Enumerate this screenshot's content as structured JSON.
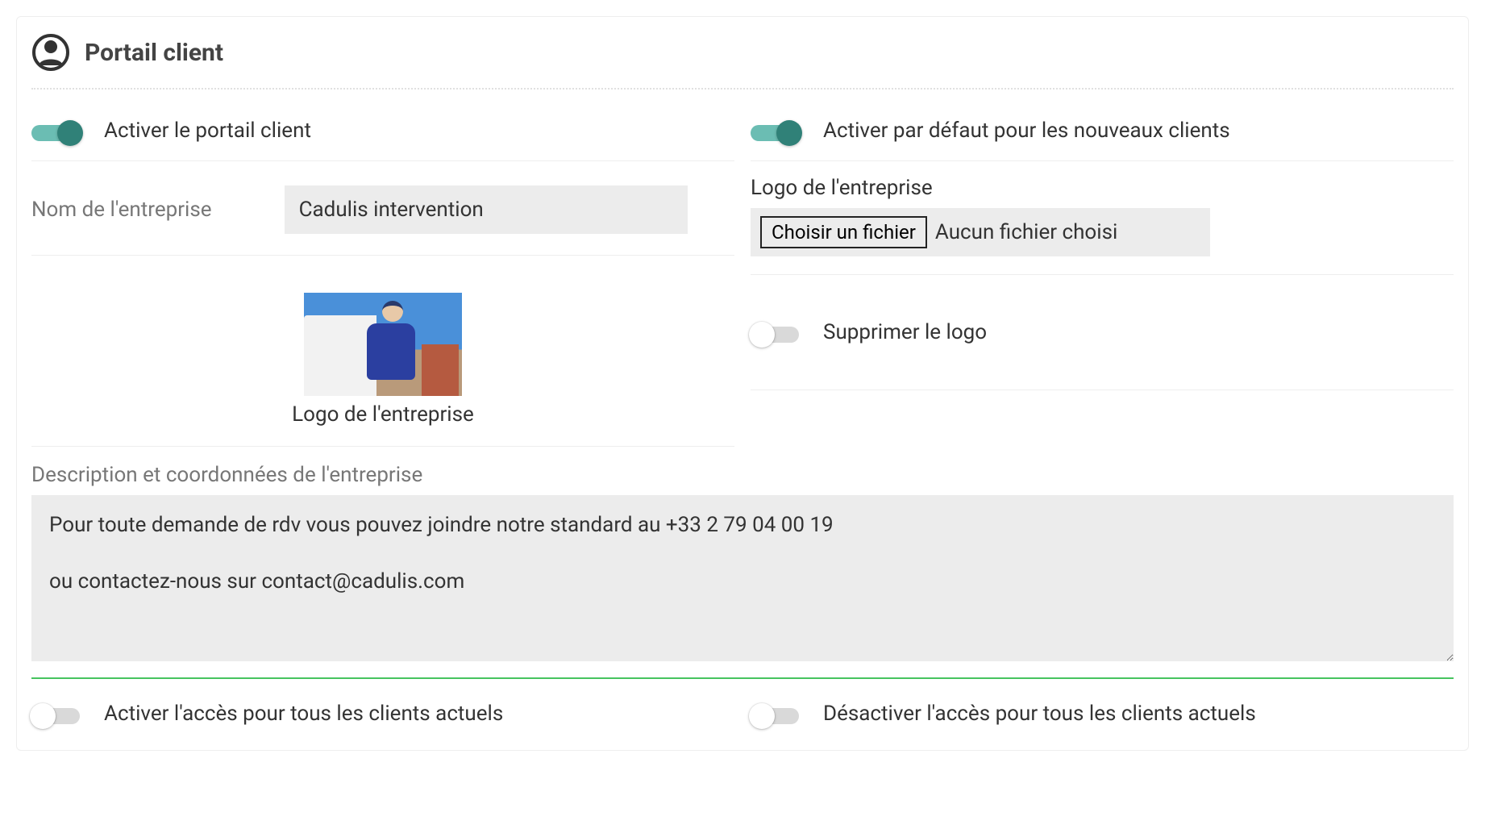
{
  "header": {
    "title": "Portail client"
  },
  "toggles": {
    "enable_portal": {
      "label": "Activer le portail client",
      "on": true
    },
    "default_new_clients": {
      "label": "Activer par défaut pour les nouveaux clients",
      "on": true
    },
    "delete_logo": {
      "label": "Supprimer le logo",
      "on": false
    },
    "enable_all": {
      "label": "Activer l'accès pour tous les clients actuels",
      "on": false
    },
    "disable_all": {
      "label": "Désactiver l'accès pour tous les clients actuels",
      "on": false
    }
  },
  "company_name": {
    "label": "Nom de l'entreprise",
    "value": "Cadulis intervention"
  },
  "logo_upload": {
    "label": "Logo de l'entreprise",
    "button": "Choisir un fichier",
    "status": "Aucun fichier choisi"
  },
  "logo_preview": {
    "caption": "Logo de l'entreprise"
  },
  "description": {
    "label": "Description et coordonnées de l'entreprise",
    "value": "Pour toute demande de rdv vous pouvez joindre notre standard au +33 2 79 04 00 19\n\nou contactez-nous sur contact@cadulis.com"
  }
}
